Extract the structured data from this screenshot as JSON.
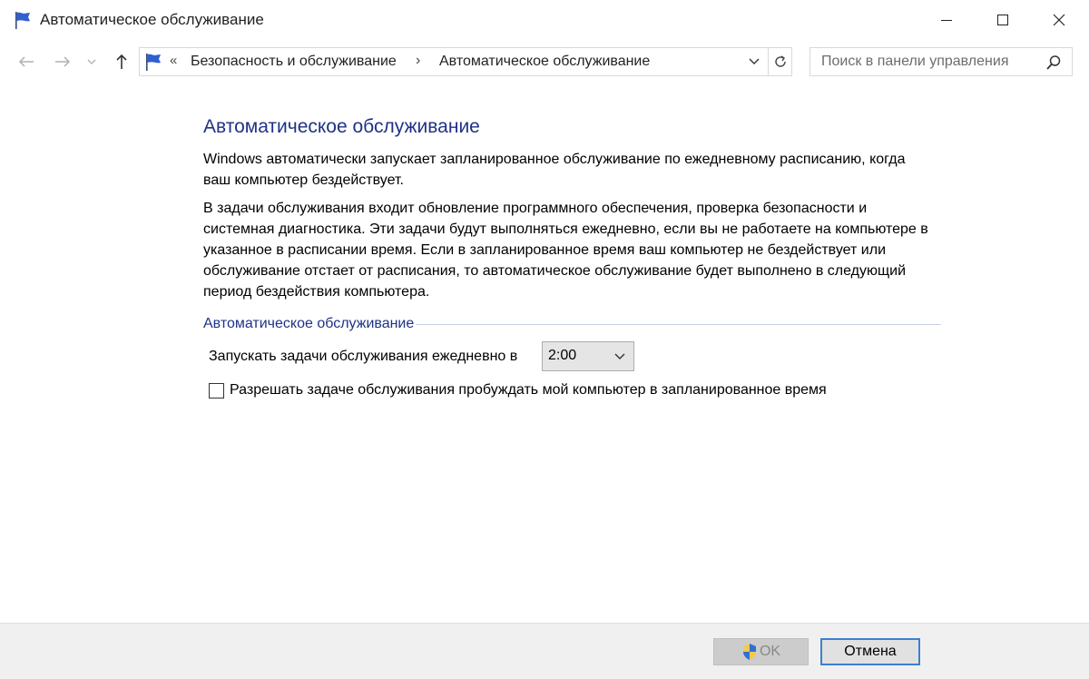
{
  "window": {
    "title": "Автоматическое обслуживание"
  },
  "address": {
    "overflow": "«",
    "crumbs": [
      "Безопасность и обслуживание",
      "Автоматическое обслуживание"
    ],
    "separator": "›"
  },
  "search": {
    "placeholder": "Поиск в панели управления"
  },
  "main": {
    "title": "Автоматическое обслуживание",
    "para1": "Windows автоматически запускает запланированное обслуживание по ежедневному расписанию, когда ваш компьютер бездействует.",
    "para2": "В задачи обслуживания входит обновление программного обеспечения, проверка безопасности и системная диагностика. Эти задачи будут выполняться ежедневно, если вы не работаете на компьютере в указанное в расписании время. Если в запланированное время ваш компьютер не бездействует или обслуживание отстает от расписания, то автоматическое обслуживание будет выполнено в следующий период бездействия компьютера.",
    "group_title": "Автоматическое обслуживание",
    "run_label": "Запускать задачи обслуживания ежедневно в",
    "run_time": "2:00",
    "wake_label": "Разрешать задаче обслуживания пробуждать мой компьютер в запланированное время",
    "wake_checked": false
  },
  "footer": {
    "ok_label": "OK",
    "cancel_label": "Отмена"
  },
  "colors": {
    "accent_title": "#1e3287",
    "focus_border": "#3c7fd1"
  }
}
